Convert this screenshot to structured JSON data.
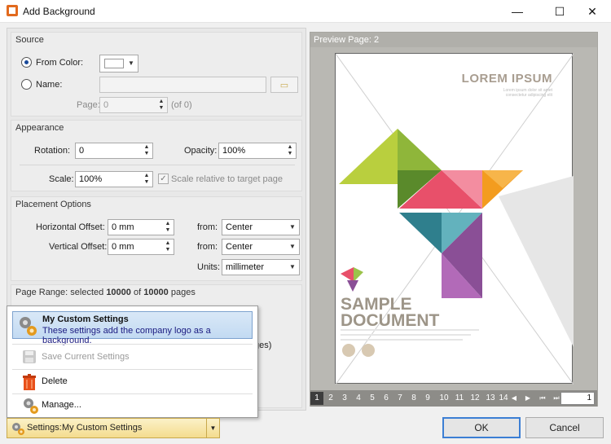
{
  "window": {
    "title": "Add Background",
    "minimize": "—",
    "maximize": "☐",
    "close": "✕"
  },
  "source": {
    "title": "Source",
    "from_color_label": "From Color:",
    "name_label": "Name:",
    "name_value": "",
    "page_label": "Page:",
    "page_value": "0",
    "page_of": "(of 0)"
  },
  "appearance": {
    "title": "Appearance",
    "rotation_label": "Rotation:",
    "rotation_value": "0",
    "opacity_label": "Opacity:",
    "opacity_value": "100%",
    "scale_label": "Scale:",
    "scale_value": "100%",
    "scale_relative_label": "Scale relative to target page"
  },
  "placement": {
    "title": "Placement Options",
    "h_offset_label": "Horizontal Offset:",
    "h_offset_value": "0 mm",
    "v_offset_label": "Vertical Offset:",
    "v_offset_value": "0 mm",
    "from_label": "from:",
    "h_from_value": "Center",
    "v_from_value": "Center",
    "units_label": "Units:",
    "units_value": "millimeter"
  },
  "page_range": {
    "prefix": "Page Range: selected ",
    "selected": "10000",
    "middle": " of ",
    "total": "10000",
    "suffix": " pages",
    "partial_text": "ges)"
  },
  "preview": {
    "title": "Preview Page: 2",
    "doc_heading": "LOREM IPSUM",
    "doc_sub1": "Lorem ipsum dolor sit amet",
    "doc_sub2": "consectetur adipiscing elit",
    "doc_title1": "SAMPLE",
    "doc_title2": "DOCUMENT",
    "pages": [
      "1",
      "2",
      "3",
      "4",
      "5",
      "6",
      "7",
      "8",
      "9",
      "10",
      "11",
      "12",
      "13",
      "14"
    ],
    "current_page": "1"
  },
  "menu": {
    "items": [
      {
        "title": "My Custom Settings",
        "subtitle": "These settings add the company logo as a background.",
        "icon": "gears-icon"
      },
      {
        "label": "Save Current Settings",
        "icon": "save-icon",
        "disabled": true
      },
      {
        "label": "Delete",
        "icon": "trash-icon"
      },
      {
        "label": "Manage...",
        "icon": "gears-icon"
      }
    ]
  },
  "settings": {
    "label": "Settings:",
    "value": "My Custom Settings"
  },
  "buttons": {
    "ok": "OK",
    "cancel": "Cancel"
  },
  "colors": {
    "accent": "#3c7fd4",
    "menu_highlight": "#c2daf2",
    "settings_bg": "#f4dc8e",
    "preview_bg": "#b9b8b3"
  }
}
